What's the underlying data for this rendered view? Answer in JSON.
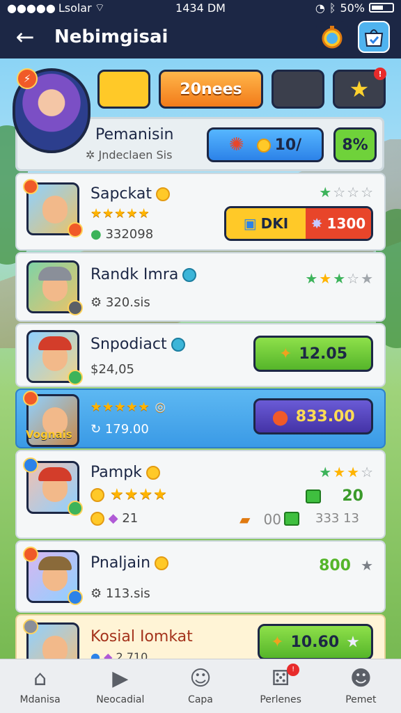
{
  "status_bar": {
    "carrier": "Lsolar",
    "time": "1434 DM",
    "battery": "50%"
  },
  "header": {
    "title": "Nebimgisai"
  },
  "top_tabs": {
    "orange_label": "20nees"
  },
  "profile": {
    "name": "Pemanisin",
    "subtitle": "Jndeclaen Sis",
    "blue_pill_value": "10/",
    "green_pill_value": "8%"
  },
  "items": [
    {
      "title": "Sapckat",
      "sub": "332098",
      "split_left": "DKI",
      "split_right": "1300"
    },
    {
      "title": "Randk Imra",
      "sub": "320.sis"
    },
    {
      "title": "Snpodiact",
      "sub": "$24,05",
      "price": "12.05"
    },
    {
      "thumb_label": "Vognais",
      "sub": "179.00",
      "price": "833.00"
    },
    {
      "title": "Pampk",
      "sub": "21",
      "mid_value": "00",
      "gem_value_1": "20",
      "gem_value_2": "333 13"
    },
    {
      "title": "Pnaljain",
      "sub": "113.sis",
      "price": "800"
    },
    {
      "title": "Kosial Iomkat",
      "sub": "2.710",
      "price": "10.60"
    }
  ],
  "bottom_nav": [
    {
      "label": "Mdanisa",
      "icon": "home-icon"
    },
    {
      "label": "Neocadial",
      "icon": "play-icon"
    },
    {
      "label": "Capa",
      "icon": "face-icon"
    },
    {
      "label": "Perlenes",
      "icon": "dice-icon"
    },
    {
      "label": "Pemet",
      "icon": "user-icon"
    }
  ]
}
